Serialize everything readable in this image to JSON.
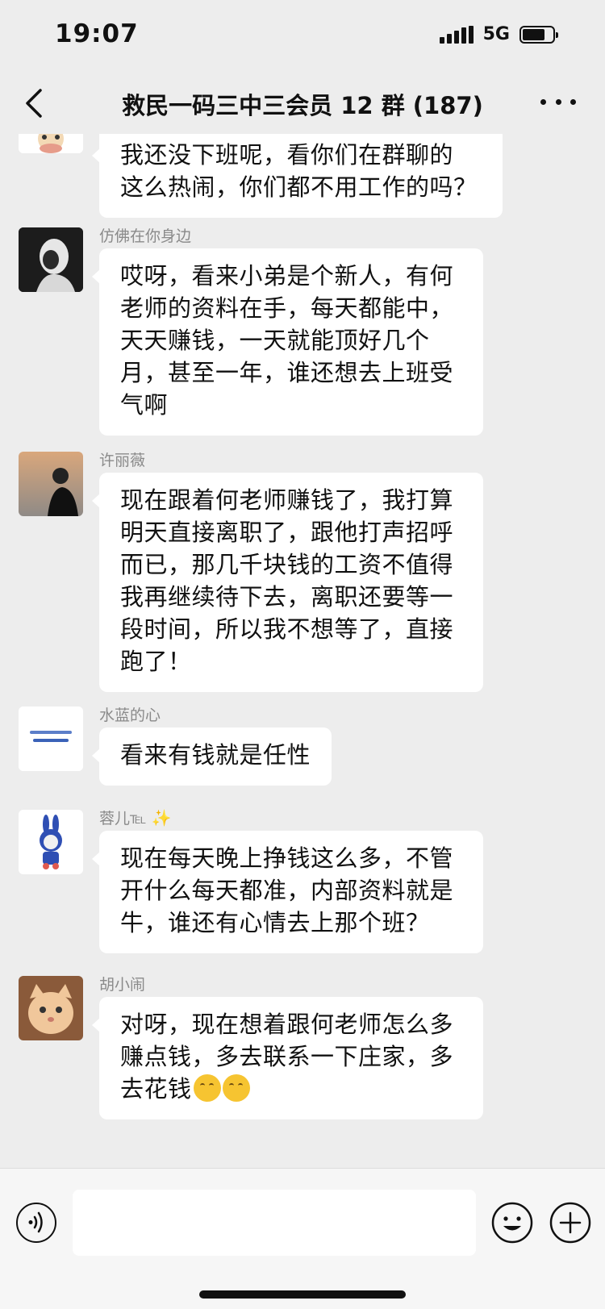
{
  "status": {
    "time": "19:07",
    "network": "5G"
  },
  "header": {
    "title": "救民一码三中三会员 12 群 (187)"
  },
  "messages": [
    {
      "sender": "",
      "lines": [
        "我还没下班呢，看你们在群聊的",
        "这么热闹，你们都不用工作的吗？"
      ]
    },
    {
      "sender": "仿佛在你身边",
      "lines": [
        "哎呀，看来小弟是个新人，有何",
        "老师的资料在手，每天都能中，",
        "天天赚钱，一天就能顶好几个",
        "月，甚至一年，谁还想去上班受",
        "气啊"
      ]
    },
    {
      "sender": "许丽薇",
      "lines": [
        "现在跟着何老师赚钱了，我打算",
        "明天直接离职了，跟他打声招呼",
        "而已，那几千块钱的工资不值得",
        "我再继续待下去，离职还要等一",
        "段时间，所以我不想等了，直接",
        "跑了！"
      ]
    },
    {
      "sender": "水蓝的心",
      "lines": [
        "看来有钱就是任性"
      ]
    },
    {
      "sender": "蓉儿℡",
      "sender_suffix": "✨",
      "lines": [
        "现在每天晚上挣钱这么多，不管",
        "开什么每天都准，内部资料就是",
        "牛，谁还有心情去上那个班？"
      ]
    },
    {
      "sender": "胡小闹",
      "lines": [
        "对呀，现在想着跟何老师怎么多",
        "赚点钱，多去联系一下庄家，多",
        "去花钱"
      ]
    }
  ],
  "colors": {
    "background": "#ededed",
    "bubble": "#ffffff",
    "sender_name": "#8a8a8a"
  },
  "icons": [
    "back-icon",
    "more-icon",
    "voice-icon",
    "emoji-icon",
    "plus-icon"
  ]
}
